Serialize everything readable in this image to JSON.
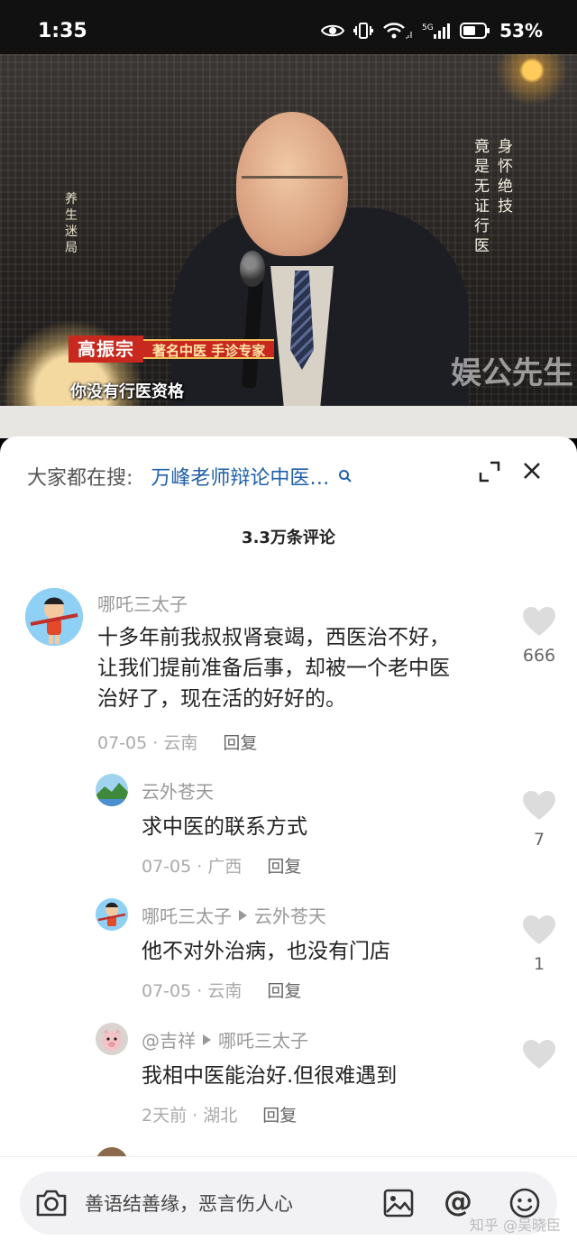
{
  "status_bar": {
    "time": "1:35",
    "battery": "53%"
  },
  "video": {
    "left_vertical_text": "养生迷局",
    "right_vertical_lines": [
      "身怀绝技",
      "竟是无证行医"
    ],
    "caption_name": "高振宗",
    "caption_title": "著名中医 手诊专家",
    "caption_sub": "你没有行医资格",
    "watermark": "娱公先生"
  },
  "sheet": {
    "search_label": "大家都在搜:",
    "search_query": "万峰老师辩论中医…",
    "comment_count": "3.3万条评论"
  },
  "comments": [
    {
      "name": "哪吒三太子",
      "text": "十多年前我叔叔肾衰竭，西医治不好，让我们提前准备后事，却被一个老中医治好了，现在活的好好的。",
      "date": "07-05",
      "location": "云南",
      "reply_label": "回复",
      "likes": "666"
    },
    {
      "name": "云外苍天",
      "text": "求中医的联系方式",
      "date": "07-05",
      "location": "广西",
      "reply_label": "回复",
      "likes": "7"
    },
    {
      "name": "哪吒三太子",
      "reply_to": "云外苍天",
      "text": "他不对外治病，也没有门店",
      "date": "07-05",
      "location": "云南",
      "reply_label": "回复",
      "likes": "1"
    },
    {
      "name": "@吉祥",
      "reply_to": "哪吒三太子",
      "text": "我相中医能治好.但很难遇到",
      "date": "2天前",
      "location": "湖北",
      "reply_label": "回复",
      "likes": ""
    }
  ],
  "input_bar": {
    "placeholder": "善语结善缘，恶言伤人心",
    "at_symbol": "@"
  },
  "watermark_bottom": "知乎 @吴晓臣"
}
